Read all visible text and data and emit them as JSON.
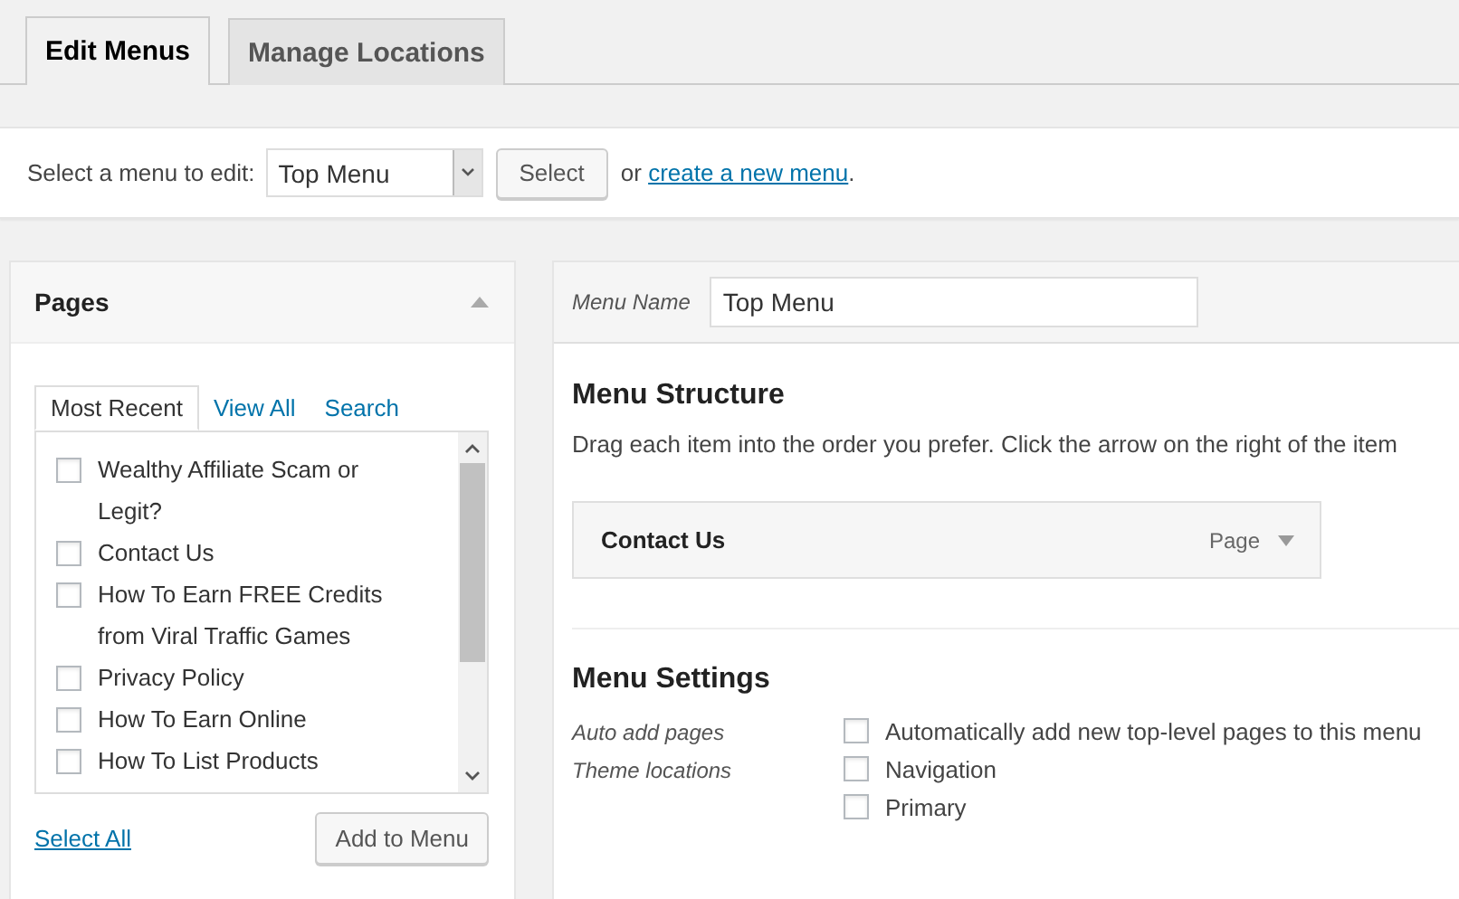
{
  "tabs": [
    {
      "label": "Edit Menus",
      "selected": true
    },
    {
      "label": "Manage Locations",
      "selected": false
    }
  ],
  "menu_select": {
    "label": "Select a menu to edit:",
    "value": "Top Menu",
    "button": "Select",
    "or_text": "or",
    "link": "create a new menu",
    "after": "."
  },
  "pages_box": {
    "title": "Pages",
    "expanded": true,
    "tabs": [
      {
        "label": "Most Recent",
        "selected": true
      },
      {
        "label": "View All",
        "selected": false
      },
      {
        "label": "Search",
        "selected": false
      }
    ],
    "items": [
      {
        "label": "Wealthy Affiliate Scam or Legit?",
        "checked": false
      },
      {
        "label": "Contact Us",
        "checked": false
      },
      {
        "label": "How To Earn FREE Credits from Viral Traffic Games",
        "checked": false
      },
      {
        "label": "Privacy Policy",
        "checked": false
      },
      {
        "label": "How To Earn Online",
        "checked": false
      },
      {
        "label": "How To List Products",
        "checked": false
      }
    ],
    "select_all": "Select All",
    "add_button": "Add to Menu"
  },
  "menu_editor": {
    "name_label": "Menu Name",
    "name_value": "Top Menu",
    "structure_title": "Menu Structure",
    "structure_hint": "Drag each item into the order you prefer. Click the arrow on the right of the item",
    "items": [
      {
        "title": "Contact Us",
        "type": "Page"
      }
    ],
    "settings_title": "Menu Settings",
    "settings": [
      {
        "label": "Auto add pages",
        "options": [
          {
            "label": "Automatically add new top-level pages to this menu",
            "checked": false
          }
        ]
      },
      {
        "label": "Theme locations",
        "options": [
          {
            "label": "Navigation",
            "checked": false
          },
          {
            "label": "Primary",
            "checked": false
          }
        ]
      }
    ]
  }
}
